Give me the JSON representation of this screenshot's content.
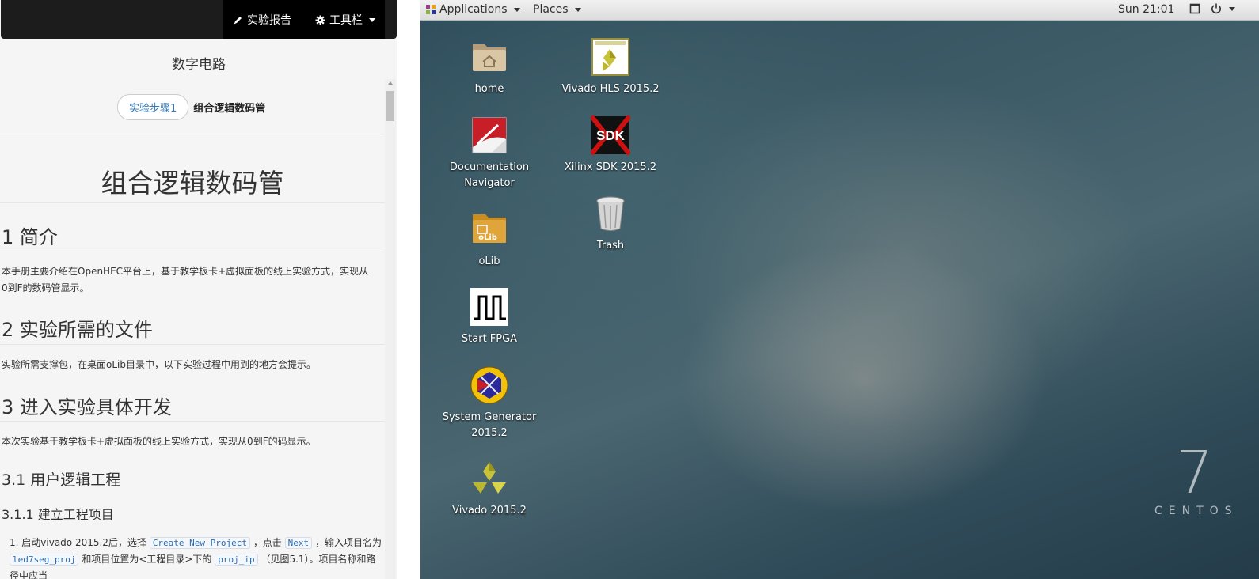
{
  "left_panel": {
    "navbar": {
      "report_label": "实验报告",
      "toolbar_label": "工具栏"
    },
    "course_title": "数字电路",
    "step_label": "实验步骤1",
    "step_title": "组合逻辑数码管",
    "doc_title": "组合逻辑数码管",
    "sections": {
      "s1_title": "1 简介",
      "s1_body": "本手册主要介绍在OpenHEC平台上，基于教学板卡+虚拟面板的线上实验方式，实现从0到F的数码管显示。",
      "s2_title": "2 实验所需的文件",
      "s2_body": "实验所需支撑包，在桌面oLib目录中，以下实验过程中用到的地方会提示。",
      "s3_title": "3 进入实验具体开发",
      "s3_body": "本次实验基于教学板卡+虚拟面板的线上实验方式，实现从0到F的码显示。",
      "s31_title": "3.1 用户逻辑工程",
      "s311_title": "3.1.1 建立工程项目"
    },
    "list_item_1": {
      "number": "1.",
      "t1": "启动vivado 2015.2后，选择",
      "c1": "Create New Project",
      "t2": "，点击",
      "c2": "Next",
      "t3": "，输入项目名为",
      "c3": "led7seg_proj",
      "t4": "和项目位置为<工程目录>下的",
      "c4": "proj_ip",
      "t5": "（见图5.1）。项目名称和路径中应当"
    }
  },
  "desktop": {
    "topbar": {
      "applications": "Applications",
      "places": "Places",
      "clock": "Sun 21:01"
    },
    "icons": [
      {
        "label": "home"
      },
      {
        "label": "Vivado HLS 2015.2"
      },
      {
        "label": "Documentation Navigator"
      },
      {
        "label": "Xilinx SDK 2015.2"
      },
      {
        "label": "Trash"
      },
      {
        "label": "oLib"
      },
      {
        "label": "Start FPGA"
      },
      {
        "label": "System Generator 2015.2"
      },
      {
        "label": "Vivado 2015.2"
      }
    ],
    "watermark": {
      "numeral": "7",
      "word": "CENTOS"
    }
  }
}
